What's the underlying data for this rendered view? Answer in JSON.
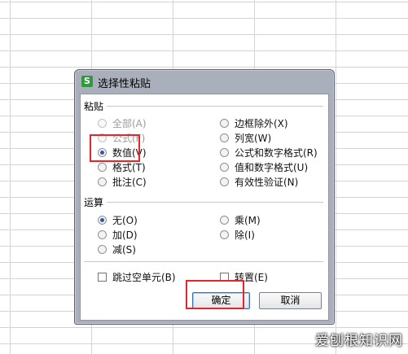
{
  "dialog": {
    "title": "选择性粘贴",
    "app_icon_glyph": "S"
  },
  "paste_group": {
    "label": "粘贴",
    "options": [
      {
        "label": "全部(A)",
        "checked": false,
        "disabled": true
      },
      {
        "label": "公式(F)",
        "checked": false,
        "disabled": true
      },
      {
        "label": "数值(V)",
        "checked": true,
        "disabled": false
      },
      {
        "label": "格式(T)",
        "checked": false,
        "disabled": false
      },
      {
        "label": "批注(C)",
        "checked": false,
        "disabled": false
      },
      {
        "label": "边框除外(X)",
        "checked": false,
        "disabled": false
      },
      {
        "label": "列宽(W)",
        "checked": false,
        "disabled": false
      },
      {
        "label": "公式和数字格式(R)",
        "checked": false,
        "disabled": false
      },
      {
        "label": "值和数字格式(U)",
        "checked": false,
        "disabled": false
      },
      {
        "label": "有效性验证(N)",
        "checked": false,
        "disabled": false
      }
    ]
  },
  "operation_group": {
    "label": "运算",
    "options": [
      {
        "label": "无(O)",
        "checked": true
      },
      {
        "label": "加(D)",
        "checked": false
      },
      {
        "label": "减(S)",
        "checked": false
      },
      {
        "label": "乘(M)",
        "checked": false
      },
      {
        "label": "除(I)",
        "checked": false
      }
    ]
  },
  "checkboxes": {
    "skip_blanks": "跳过空单元(B)",
    "transpose": "转置(E)"
  },
  "buttons": {
    "ok": "确定",
    "cancel": "取消"
  },
  "watermark": "爱刨根知识网",
  "colors": {
    "highlight": "#e3262b",
    "radio_dot": "#2d5aa3",
    "app_icon": "#2f9a3d"
  }
}
